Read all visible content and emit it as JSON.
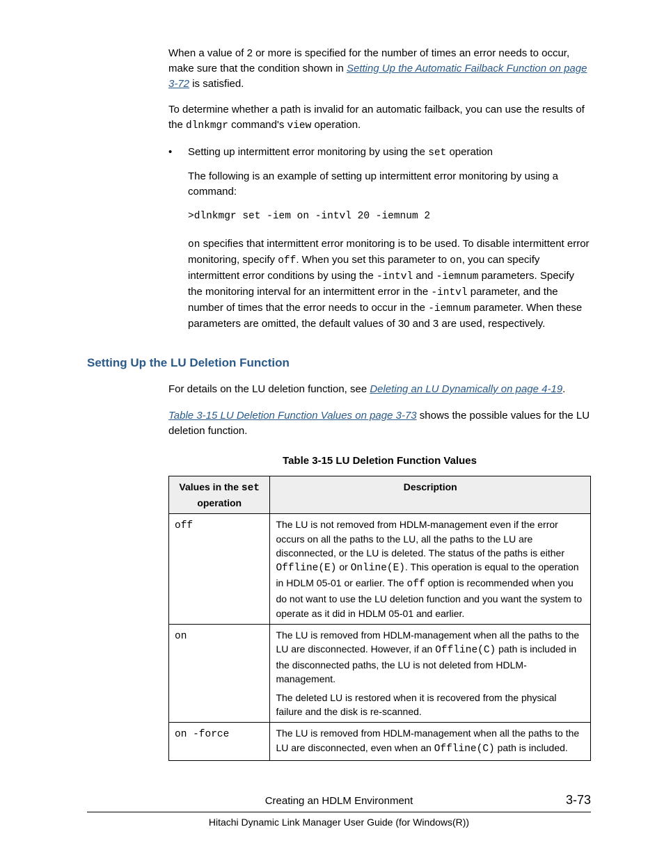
{
  "para1": {
    "part1": "When a value of 2 or more is specified for the number of times an error needs to occur, make sure that the condition shown in ",
    "link": "Setting Up the Automatic Failback Function on page 3-72",
    "part2": " is satisfied."
  },
  "para2": {
    "part1": "To determine whether a path is invalid for an automatic failback, you can use the results of the ",
    "code1": "dlnkmgr",
    "mid": " command's ",
    "code2": "view",
    "part2": " operation."
  },
  "bullet": {
    "line1a": "Setting up intermittent error monitoring by using the ",
    "line1code": "set",
    "line1b": " operation",
    "line2": "The following is an example of setting up intermittent error monitoring by using a command:",
    "command": ">dlnkmgr set -iem on -intvl 20 -iemnum 2",
    "p3_code_on1": "on",
    "p3_a": " specifies that intermittent error monitoring is to be used. To disable intermittent error monitoring, specify ",
    "p3_code_off": "off",
    "p3_b": ". When you set this parameter to ",
    "p3_code_on2": "on",
    "p3_c": ", you can specify intermittent error conditions by using the ",
    "p3_code_intvl1": "-intvl",
    "p3_d": " and ",
    "p3_code_iemnum1": "-iemnum",
    "p3_e": " parameters. Specify the monitoring interval for an intermittent error in the ",
    "p3_code_intvl2": "-intvl",
    "p3_f": " parameter, and the number of times that the error needs to occur in the ",
    "p3_code_iemnum2": "-iemnum",
    "p3_g": " parameter. When these parameters are omitted, the default values of 30 and 3 are used, respectively."
  },
  "heading": "Setting Up the LU Deletion Function",
  "para3": {
    "a": "For details on the LU deletion function, see ",
    "link": "Deleting an LU Dynamically on page 4-19",
    "b": "."
  },
  "para4": {
    "link": "Table 3-15 LU Deletion Function Values on page 3-73",
    "b": " shows the possible values for the LU deletion function."
  },
  "table": {
    "caption": "Table 3-15 LU Deletion Function Values",
    "head_col1a": "Values in the ",
    "head_col1code": "set",
    "head_col1b": " operation",
    "head_col2": "Description",
    "rows": [
      {
        "value_code": "off",
        "desc_a": "The LU is not removed from HDLM-management even if the error occurs on all the paths to the LU, all the paths to the LU are disconnected, or the LU is deleted. The status of the paths is either ",
        "desc_code1": "Offline(E)",
        "desc_mid": " or ",
        "desc_code2": "Online(E)",
        "desc_b": ". This operation is equal to the operation in HDLM 05-01 or earlier. The ",
        "desc_code3": "off",
        "desc_c": " option is recommended when you do not want to use the LU deletion function and you want the system to operate as it did in HDLM 05-01 and earlier."
      },
      {
        "value_code": "on",
        "p1_a": "The LU is removed from HDLM-management when all the paths to the LU are disconnected. However, if an ",
        "p1_code": "Offline(C)",
        "p1_b": " path is included in the disconnected paths, the LU is not deleted from HDLM-management.",
        "p2": "The deleted LU is restored when it is recovered from the physical failure and the disk is re-scanned."
      },
      {
        "value_code": "on -force",
        "desc_a": "The LU is removed from HDLM-management when all the paths to the LU are disconnected, even when an ",
        "desc_code": "Offline(C)",
        "desc_b": " path is included."
      }
    ]
  },
  "footer": {
    "section": "Creating an HDLM Environment",
    "page": "3-73",
    "guide": "Hitachi Dynamic Link Manager User Guide (for Windows(R))"
  }
}
